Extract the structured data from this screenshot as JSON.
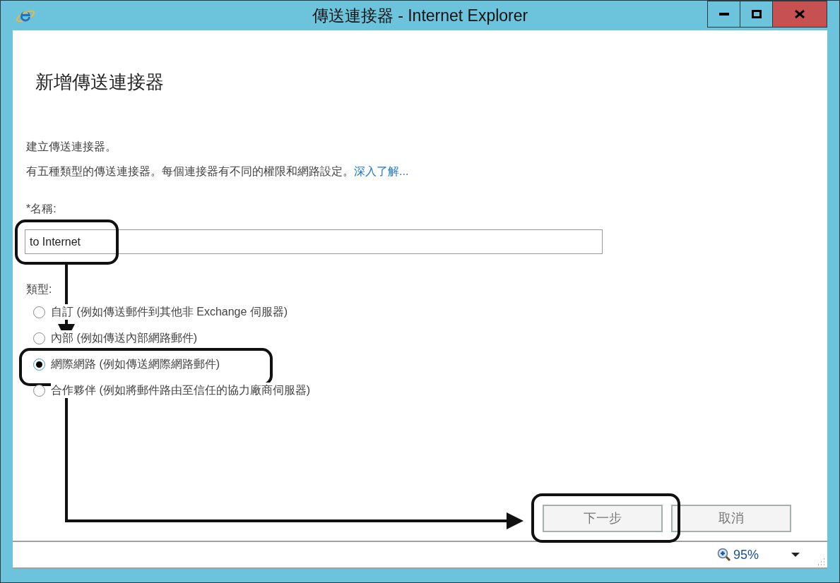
{
  "window": {
    "title": "傳送連接器 - Internet Explorer"
  },
  "heading": "新增傳送連接器",
  "intro": {
    "line_1": "建立傳送連接器。",
    "line_2": "有五種類型的傳送連接器。每個連接器有不同的權限和網路設定。",
    "link": "深入了解..."
  },
  "name_field": {
    "label": "*名稱:",
    "value": "to Internet"
  },
  "type_group": {
    "label": "類型:",
    "options": [
      {
        "label": "自訂 (例如傳送郵件到其他非 Exchange 伺服器)",
        "selected": false
      },
      {
        "label": "內部 (例如傳送內部網路郵件)",
        "selected": false
      },
      {
        "label": "網際網路 (例如傳送網際網路郵件)",
        "selected": true
      },
      {
        "label": "合作夥伴 (例如將郵件路由至信任的協力廠商伺服器)",
        "selected": false
      }
    ]
  },
  "buttons": [
    "下一步",
    "取消"
  ],
  "status_bar": {
    "zoom": "95%"
  }
}
